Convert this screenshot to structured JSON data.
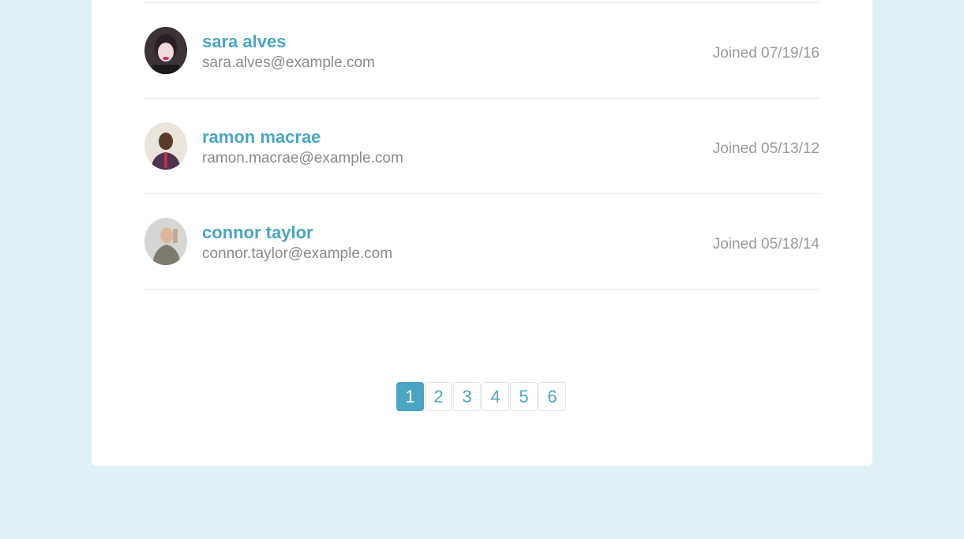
{
  "users": [
    {
      "name": "sara alves",
      "email": "sara.alves@example.com",
      "joined": "Joined 07/19/16"
    },
    {
      "name": "ramon macrae",
      "email": "ramon.macrae@example.com",
      "joined": "Joined 05/13/12"
    },
    {
      "name": "connor taylor",
      "email": "connor.taylor@example.com",
      "joined": "Joined 05/18/14"
    }
  ],
  "pagination": {
    "pages": [
      "1",
      "2",
      "3",
      "4",
      "5",
      "6"
    ],
    "current": "1"
  },
  "colors": {
    "background": "#e1eff7",
    "accent": "#4aa5c2",
    "muted_text": "#8a8a8a"
  }
}
